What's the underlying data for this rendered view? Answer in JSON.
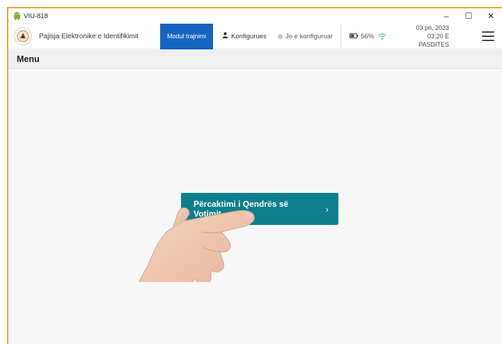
{
  "window": {
    "title": "VIU-818",
    "controls": {
      "minimize": "–",
      "maximize": "☐",
      "close": "✕"
    }
  },
  "appbar": {
    "app_title": "Pajisja Elektronike e Identifikimit",
    "mode_button": "Modul trajnimi",
    "config_button": "Konfigurues",
    "config_status": "Jo e konfiguruar",
    "battery": "56%",
    "date": "03 pri, 2023",
    "time": "03:20 E PASDITES"
  },
  "menubar": {
    "title": "Menu"
  },
  "main": {
    "action_button": "Përcaktimi i Qendrës së Votimit",
    "action_chevron": "›"
  },
  "colors": {
    "accent_blue": "#1565c0",
    "action_teal": "#0d7f8c",
    "window_border": "#e8a33d",
    "android_green": "#7cb342",
    "wifi_green": "#2ecc71"
  }
}
